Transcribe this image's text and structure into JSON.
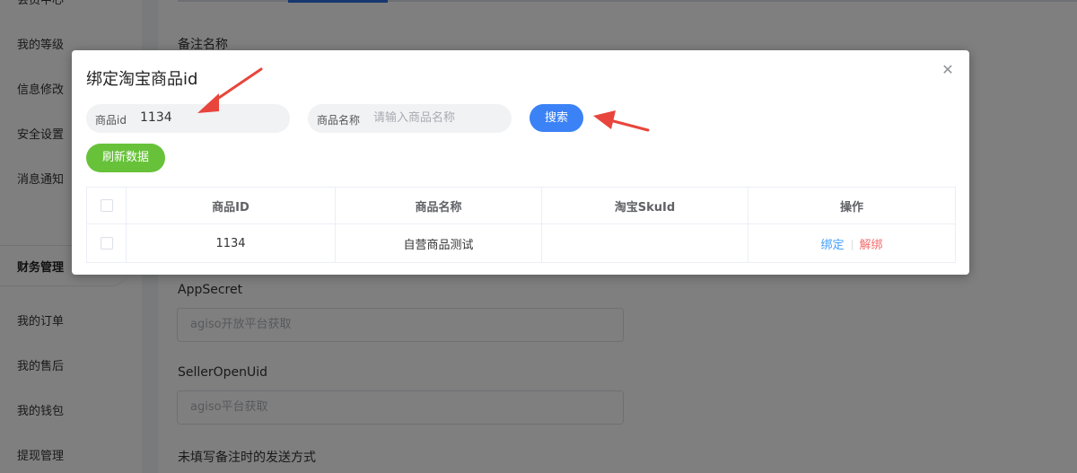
{
  "sidebar": {
    "items_top": [
      "会员中心",
      "我的等级",
      "信息修改",
      "安全设置",
      "消息通知"
    ],
    "section_label": "财务管理",
    "items_bottom": [
      "我的订单",
      "我的售后",
      "我的钱包",
      "提现管理"
    ]
  },
  "form": {
    "remark_label": "备注名称",
    "appsecret_label": "AppSecret",
    "appsecret_placeholder": "agiso开放平台获取",
    "selleropenuid_label": "SellerOpenUid",
    "selleropenuid_placeholder": "agiso平台获取",
    "send_mode_label": "未填写备注时的发送方式"
  },
  "dialog": {
    "title": "绑定淘宝商品id",
    "product_id_label": "商品id",
    "product_id_value": "1134",
    "product_name_label": "商品名称",
    "product_name_placeholder": "请输入商品名称",
    "search_button": "搜索",
    "refresh_button": "刷新数据",
    "close_icon": "close-icon",
    "table": {
      "headers": [
        "商品ID",
        "商品名称",
        "淘宝SkuId",
        "操作"
      ],
      "rows": [
        {
          "id": "1134",
          "name": "自营商品测试",
          "sku": "",
          "bind": "绑定",
          "unbind": "解绑"
        }
      ]
    }
  },
  "colors": {
    "primary": "#3b82f6",
    "success": "#67c23a",
    "link": "#409eff",
    "danger": "#f56c6c",
    "annotation_arrow": "#e8453c"
  }
}
